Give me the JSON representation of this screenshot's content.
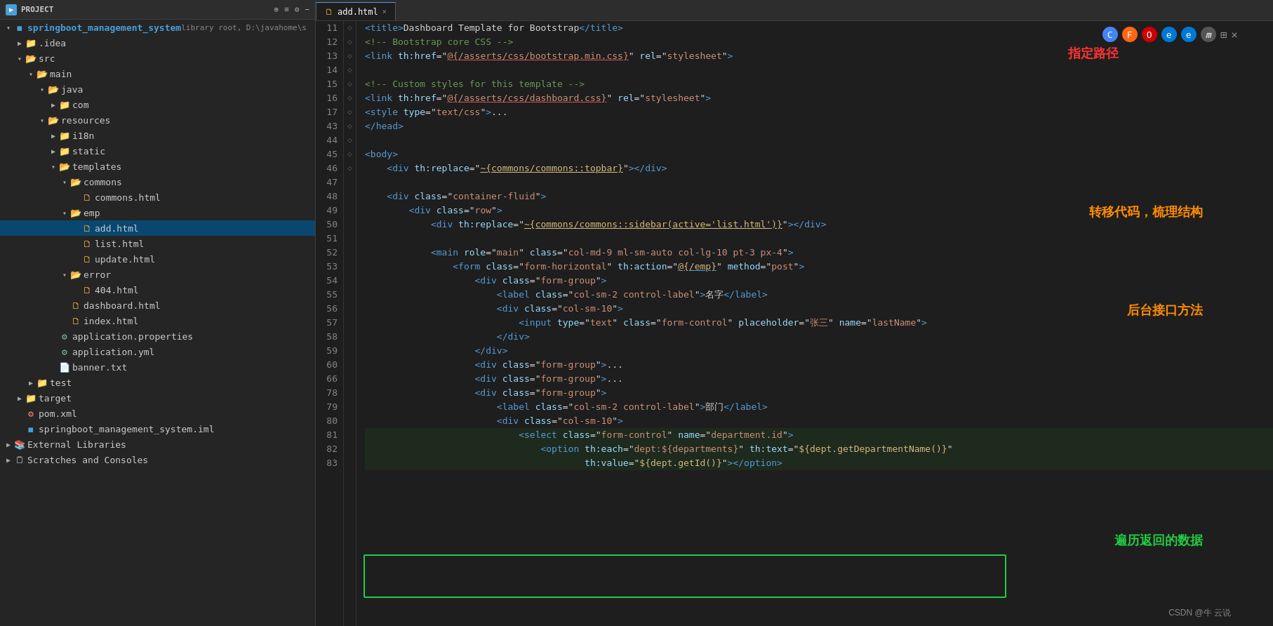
{
  "titlebar": {
    "project_label": "Project",
    "dropdown_arrow": "▾"
  },
  "sidebar": {
    "header": "Project",
    "icons": [
      "⊕",
      "≡",
      "⚙",
      "−"
    ],
    "tree": [
      {
        "id": "root",
        "label": "springboot_management_system",
        "sublabel": "library root, D:\\javahome\\s",
        "type": "root",
        "indent": 0,
        "open": true
      },
      {
        "id": "idea",
        "label": ".idea",
        "type": "folder",
        "indent": 1,
        "open": false
      },
      {
        "id": "src",
        "label": "src",
        "type": "folder",
        "indent": 1,
        "open": true
      },
      {
        "id": "main",
        "label": "main",
        "type": "folder",
        "indent": 2,
        "open": true
      },
      {
        "id": "java",
        "label": "java",
        "type": "folder",
        "indent": 3,
        "open": true
      },
      {
        "id": "com",
        "label": "com",
        "type": "folder",
        "indent": 4,
        "open": false
      },
      {
        "id": "resources",
        "label": "resources",
        "type": "folder",
        "indent": 3,
        "open": true
      },
      {
        "id": "i18n",
        "label": "i18n",
        "type": "folder",
        "indent": 4,
        "open": false
      },
      {
        "id": "static",
        "label": "static",
        "type": "folder",
        "indent": 4,
        "open": false
      },
      {
        "id": "templates",
        "label": "templates",
        "type": "folder",
        "indent": 4,
        "open": true
      },
      {
        "id": "commons",
        "label": "commons",
        "type": "folder",
        "indent": 5,
        "open": true
      },
      {
        "id": "commons_html",
        "label": "commons.html",
        "type": "html",
        "indent": 6,
        "open": false
      },
      {
        "id": "emp",
        "label": "emp",
        "type": "folder",
        "indent": 5,
        "open": true
      },
      {
        "id": "add_html",
        "label": "add.html",
        "type": "html",
        "indent": 6,
        "open": false,
        "selected": true
      },
      {
        "id": "list_html",
        "label": "list.html",
        "type": "html",
        "indent": 6,
        "open": false
      },
      {
        "id": "update_html",
        "label": "update.html",
        "type": "html",
        "indent": 6,
        "open": false
      },
      {
        "id": "error",
        "label": "error",
        "type": "folder",
        "indent": 5,
        "open": true
      },
      {
        "id": "404_html",
        "label": "404.html",
        "type": "html",
        "indent": 6,
        "open": false
      },
      {
        "id": "dashboard_html",
        "label": "dashboard.html",
        "type": "html",
        "indent": 5,
        "open": false
      },
      {
        "id": "index_html",
        "label": "index.html",
        "type": "html",
        "indent": 5,
        "open": false
      },
      {
        "id": "app_props",
        "label": "application.properties",
        "type": "props",
        "indent": 4,
        "open": false
      },
      {
        "id": "app_yml",
        "label": "application.yml",
        "type": "yml",
        "indent": 4,
        "open": false
      },
      {
        "id": "banner",
        "label": "banner.txt",
        "type": "txt",
        "indent": 4,
        "open": false
      },
      {
        "id": "test",
        "label": "test",
        "type": "folder",
        "indent": 2,
        "open": false
      },
      {
        "id": "target",
        "label": "target",
        "type": "folder",
        "indent": 1,
        "open": false
      },
      {
        "id": "pom_xml",
        "label": "pom.xml",
        "type": "xml",
        "indent": 1,
        "open": false
      },
      {
        "id": "sys_iml",
        "label": "springboot_management_system.iml",
        "type": "iml",
        "indent": 1,
        "open": false
      },
      {
        "id": "ext_libs",
        "label": "External Libraries",
        "type": "folder",
        "indent": 0,
        "open": false
      },
      {
        "id": "scratches",
        "label": "Scratches and Consoles",
        "type": "folder",
        "indent": 0,
        "open": false
      }
    ]
  },
  "editor": {
    "tab_label": "add.html",
    "tab_close": "×",
    "lines": [
      {
        "num": 11,
        "fold": "",
        "content": "line11"
      },
      {
        "num": 12,
        "fold": "",
        "content": "line12"
      },
      {
        "num": 13,
        "fold": "",
        "content": "line13"
      },
      {
        "num": 14,
        "fold": "",
        "content": "line14"
      },
      {
        "num": 15,
        "fold": "",
        "content": "line15"
      },
      {
        "num": 16,
        "fold": "",
        "content": "line16"
      },
      {
        "num": 17,
        "fold": "",
        "content": "line17"
      },
      {
        "num": 43,
        "fold": "",
        "content": "line43"
      },
      {
        "num": 44,
        "fold": "",
        "content": "line44"
      },
      {
        "num": 45,
        "fold": "",
        "content": "line45"
      },
      {
        "num": 46,
        "fold": "◇",
        "content": "line46"
      },
      {
        "num": 47,
        "fold": "",
        "content": "line47"
      },
      {
        "num": 48,
        "fold": "◇",
        "content": "line48"
      },
      {
        "num": 49,
        "fold": "◇",
        "content": "line49"
      },
      {
        "num": 50,
        "fold": "◇",
        "content": "line50"
      },
      {
        "num": 51,
        "fold": "",
        "content": "line51"
      },
      {
        "num": 52,
        "fold": "◇",
        "content": "line52"
      },
      {
        "num": 53,
        "fold": "◇",
        "content": "line53"
      },
      {
        "num": 54,
        "fold": "◇",
        "content": "line54"
      },
      {
        "num": 55,
        "fold": "",
        "content": "line55"
      },
      {
        "num": 56,
        "fold": "◇",
        "content": "line56"
      },
      {
        "num": 57,
        "fold": "",
        "content": "line57"
      },
      {
        "num": 58,
        "fold": "",
        "content": "line58"
      },
      {
        "num": 59,
        "fold": "",
        "content": "line59"
      },
      {
        "num": 60,
        "fold": "",
        "content": "line60"
      },
      {
        "num": 66,
        "fold": "",
        "content": "line66"
      },
      {
        "num": 78,
        "fold": "◇",
        "content": "line78"
      },
      {
        "num": 79,
        "fold": "",
        "content": "line79"
      },
      {
        "num": 80,
        "fold": "◇",
        "content": "line80"
      },
      {
        "num": 81,
        "fold": "◇",
        "content": "line81"
      },
      {
        "num": 82,
        "fold": "",
        "content": "line82"
      },
      {
        "num": 83,
        "fold": "",
        "content": "line83"
      }
    ]
  },
  "annotations": {
    "zhiding_lujing": "指定路径",
    "zhuanyi_daima": "转移代码，梳理结构",
    "houtai_jiekou": "后台接口方法",
    "bianli_fanhui": "遍历返回的数据"
  },
  "watermark": "CSDN @牛 云说",
  "status": {
    "text": ""
  }
}
